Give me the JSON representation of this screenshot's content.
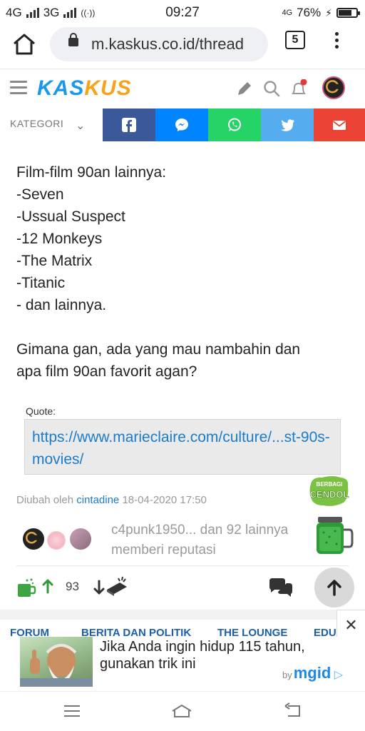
{
  "status_bar": {
    "net1": "4G",
    "net2": "3G",
    "time": "09:27",
    "net3": "4G",
    "battery": "76%",
    "battery_level": 0.76
  },
  "browser": {
    "url": "m.kaskus.co.id/thread",
    "tab_count": "5"
  },
  "header": {
    "logo_part1": "KAS",
    "logo_part2": "KUS",
    "notification_dot_color": "#e53935"
  },
  "category_bar": {
    "label": "KATEGORI",
    "share": [
      {
        "name": "facebook",
        "color": "#3b5998"
      },
      {
        "name": "messenger",
        "color": "#0084ff"
      },
      {
        "name": "whatsapp",
        "color": "#25d366"
      },
      {
        "name": "twitter",
        "color": "#55acee"
      },
      {
        "name": "email",
        "color": "#ea4335"
      }
    ]
  },
  "post": {
    "lines": [
      "Film-film 90an lainnya:",
      "-Seven",
      "-Ussual Suspect",
      "-12 Monkeys",
      "-The Matrix",
      "-Titanic",
      "- dan lainnya."
    ],
    "question_line1": "Gimana gan, ada yang mau nambahin dan",
    "question_line2": "apa film 90an favorit agan?"
  },
  "quote": {
    "label": "Quote:",
    "link": "https://www.marieclaire.com/culture/...st-90s-movies/"
  },
  "edit_info": {
    "prefix": "Diubah oleh",
    "user": "cintadine",
    "datetime": "18-04-2020 17:50"
  },
  "cendol_badge": {
    "line1": "BERBAGI",
    "line2": "CENDOL"
  },
  "reputation": {
    "line1": "c4punk1950... dan 92 lainnya",
    "line2": "memberi reputasi"
  },
  "actions": {
    "vote_count": "93"
  },
  "forum_nav": [
    "FORUM",
    "BERITA DAN POLITIK",
    "THE LOUNGE",
    "EDU"
  ],
  "ad": {
    "line1": "Jika Anda ingin hidup 115 tahun,",
    "line2": "gunakan trik ini",
    "by": "by",
    "brand": "mgid"
  }
}
